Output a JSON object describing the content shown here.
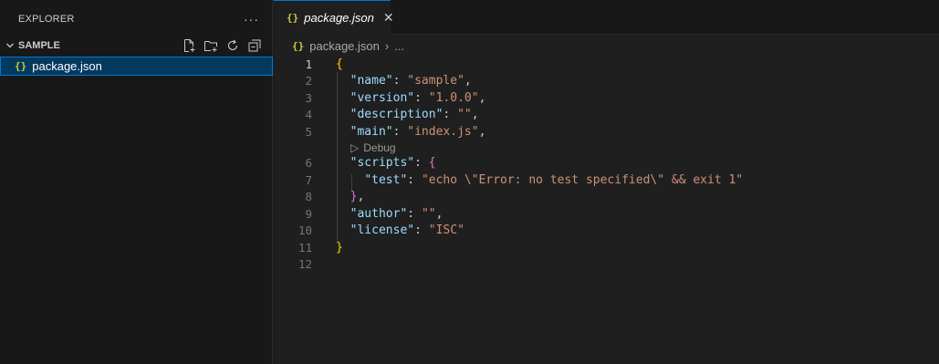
{
  "sidebar": {
    "title": "EXPLORER",
    "more_label": "···",
    "section_title": "SAMPLE",
    "actions": [
      "new-file",
      "new-folder",
      "refresh",
      "collapse-all"
    ],
    "files": [
      {
        "name": "package.json",
        "icon": "{}"
      }
    ]
  },
  "editor": {
    "tab": {
      "icon": "{}",
      "label": "package.json",
      "close": "✕"
    },
    "breadcrumb": {
      "icon": "{}",
      "file": "package.json",
      "sep": "›",
      "tail": "..."
    },
    "codelens": {
      "icon": "▷",
      "label": "Debug"
    },
    "line_numbers": [
      "1",
      "2",
      "3",
      "4",
      "5",
      "6",
      "7",
      "8",
      "9",
      "10",
      "11",
      "12"
    ],
    "code": {
      "l1_open": "{",
      "name_key": "\"name\"",
      "name_val": "\"sample\"",
      "version_key": "\"version\"",
      "version_val": "\"1.0.0\"",
      "description_key": "\"description\"",
      "description_val": "\"\"",
      "main_key": "\"main\"",
      "main_val": "\"index.js\"",
      "scripts_key": "\"scripts\"",
      "scripts_open": "{",
      "test_key": "\"test\"",
      "test_val": "\"echo \\\"Error: no test specified\\\" && exit 1\"",
      "scripts_close": "}",
      "author_key": "\"author\"",
      "author_val": "\"\"",
      "license_key": "\"license\"",
      "license_val": "\"ISC\"",
      "l11_close": "}"
    }
  },
  "colors": {
    "accent": "#0078d4",
    "key": "#9cdcfe",
    "string": "#ce9178",
    "bracket1": "#ffd700",
    "bracket2": "#da70d6"
  }
}
